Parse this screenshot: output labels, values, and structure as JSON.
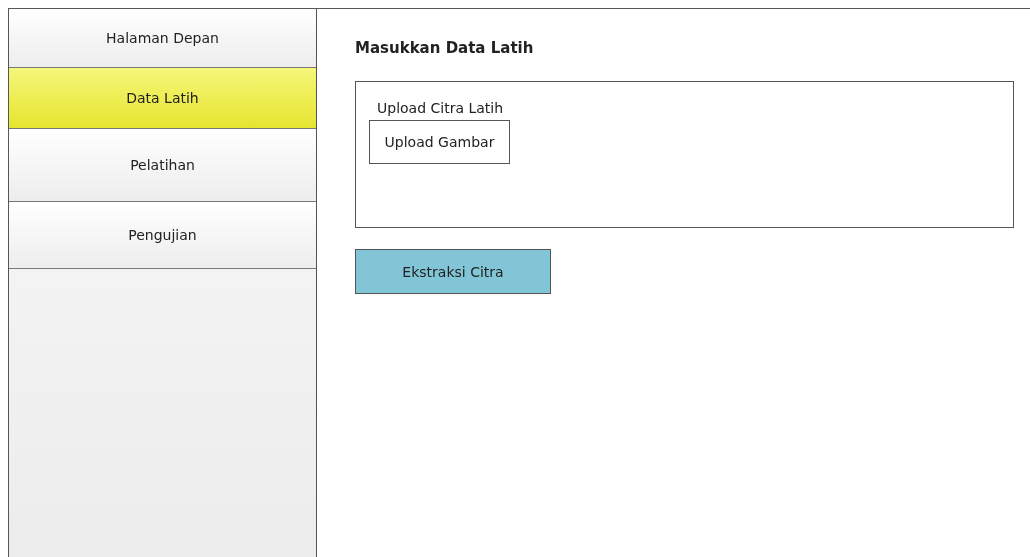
{
  "sidebar": {
    "items": [
      {
        "label": "Halaman Depan",
        "selected": false
      },
      {
        "label": "Data Latih",
        "selected": true
      },
      {
        "label": "Pelatihan",
        "selected": false
      },
      {
        "label": "Pengujian",
        "selected": false
      }
    ]
  },
  "main": {
    "title": "Masukkan Data Latih",
    "upload_panel": {
      "label": "Upload Citra Latih",
      "button": "Upload Gambar"
    },
    "action_button": "Ekstraksi Citra"
  }
}
